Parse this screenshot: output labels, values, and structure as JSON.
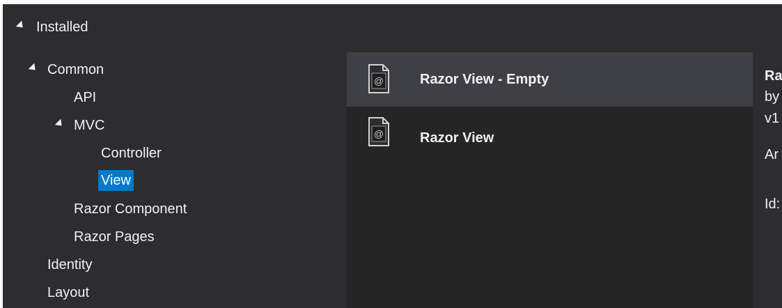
{
  "tree": {
    "root_label": "Installed",
    "common_label": "Common",
    "api_label": "API",
    "mvc_label": "MVC",
    "controller_label": "Controller",
    "view_label": "View",
    "razor_component_label": "Razor Component",
    "razor_pages_label": "Razor Pages",
    "identity_label": "Identity",
    "layout_label": "Layout"
  },
  "templates": [
    {
      "title": "Razor View - Empty",
      "icon": "razor-file-icon",
      "selected": true
    },
    {
      "title": "Razor View",
      "icon": "razor-file-icon",
      "selected": false
    }
  ],
  "details": {
    "name_fragment": "Ra",
    "author_fragment": "by",
    "version_fragment": "v1",
    "description_fragment": "Ar",
    "id_fragment": "Id:"
  },
  "colors": {
    "background": "#2d2d30",
    "list_background": "#252526",
    "selection_accent": "#007acc",
    "active_item": "#3f3f46"
  }
}
